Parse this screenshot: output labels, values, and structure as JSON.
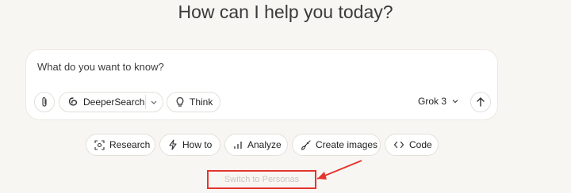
{
  "header": {
    "headline": "How can I help you today?"
  },
  "composer": {
    "placeholder": "What do you want to know?",
    "deepersearch_label": "DeeperSearch",
    "think_label": "Think",
    "model_label": "Grok 3"
  },
  "actions": [
    {
      "label": "Research",
      "icon": "research-icon"
    },
    {
      "label": "How to",
      "icon": "lightning-icon"
    },
    {
      "label": "Analyze",
      "icon": "bar-chart-icon"
    },
    {
      "label": "Create images",
      "icon": "brush-icon"
    },
    {
      "label": "Code",
      "icon": "code-icon"
    }
  ],
  "switch_link": {
    "label": "Switch to Personas"
  },
  "annotation": {
    "color": "#e4352c"
  }
}
